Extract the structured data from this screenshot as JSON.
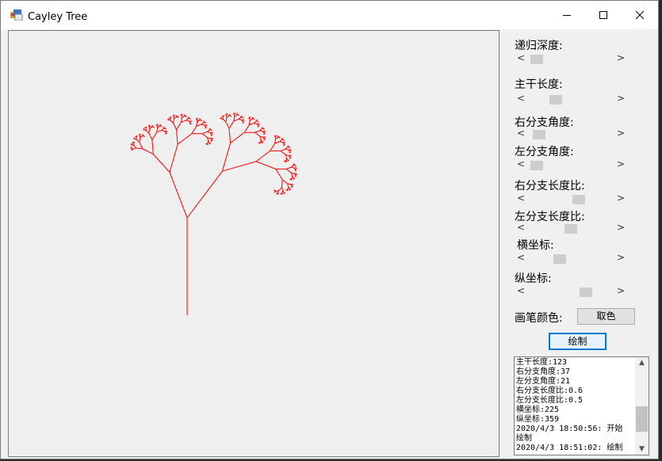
{
  "window": {
    "title": "Cayley Tree",
    "minimize": "—",
    "maximize": "☐",
    "close": "✕"
  },
  "controls": {
    "depth_label": "递归深度:",
    "trunk_length_label": "主干长度:",
    "right_angle_label": "右分支角度:",
    "left_angle_label": "左分支角度:",
    "right_ratio_label": "右分支长度比:",
    "left_ratio_label": "左分支长度比:",
    "x_label": "横坐标:",
    "y_label": "纵坐标:",
    "pen_color_label": "画笔颜色:",
    "pick_color_button": "取色",
    "draw_button": "绘制"
  },
  "sliders": [
    {
      "name": "depth-slider",
      "value": 0.05
    },
    {
      "name": "trunk-length-slider",
      "value": 0.3
    },
    {
      "name": "right-angle-slider",
      "value": 0.08
    },
    {
      "name": "left-angle-slider",
      "value": 0.05
    },
    {
      "name": "right-ratio-slider",
      "value": 0.6
    },
    {
      "name": "left-ratio-slider",
      "value": 0.5
    },
    {
      "name": "x-slider",
      "value": 0.35
    },
    {
      "name": "y-slider",
      "value": 0.7
    }
  ],
  "log": {
    "lines": [
      "主干长度:123",
      "右分支角度:37",
      "左分支角度:21",
      "右分支长度比:0.6",
      "左分支长度比:0.5",
      "横坐标:225",
      "纵坐标:359",
      "2020/4/3 18:50:56: 开始",
      "绘制",
      "2020/4/3 18:51:02: 绘制"
    ]
  },
  "colors": {
    "pen": "#ff0000",
    "accent": "#0078d7"
  }
}
